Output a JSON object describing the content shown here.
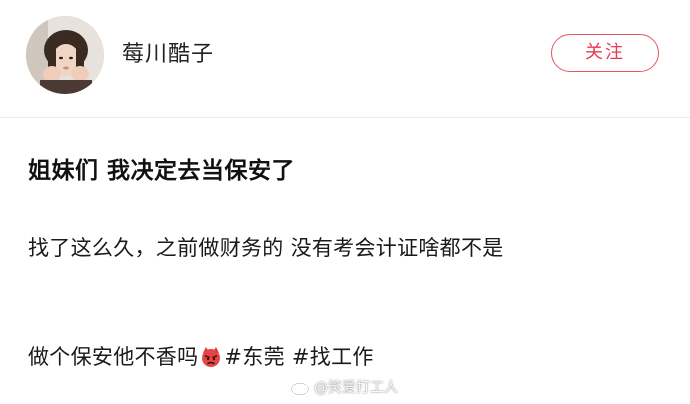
{
  "user": {
    "name": "莓川酷子",
    "follow_label": "关注"
  },
  "post": {
    "title": "姐妹们 我决定去当保安了",
    "body": "找了这么久，之前做财务的 没有考会计证啥都不是",
    "tagline_text": "做个保安他不香吗",
    "emoji": "angry-face-emoji",
    "hashtags": [
      "#东莞",
      "#找工作"
    ]
  },
  "watermark": {
    "icon": "weibo-icon",
    "text": "@笑爱打工人"
  },
  "colors": {
    "accent": "#e53a55",
    "text": "#111111",
    "divider": "#ececec"
  }
}
